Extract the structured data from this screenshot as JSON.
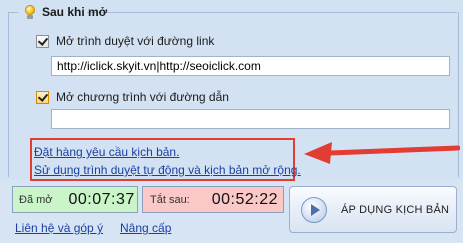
{
  "group": {
    "title": "Sau khi mở"
  },
  "option_browser": {
    "label": "Mở trình duyệt với đường link",
    "checked": true,
    "value": "http://iclick.skyit.vn|http://seoiclick.com"
  },
  "option_program": {
    "label": "Mở chương trình với đường dẫn",
    "checked": true,
    "value": ""
  },
  "links": {
    "order_script": "Đặt hàng yêu cầu kịch bản.",
    "use_browser": "Sử dụng trình duyệt tự động và kịch bản mở rộng."
  },
  "timers": {
    "opened_label": "Đã mở",
    "opened_value": "00:07:37",
    "shutdown_label": "Tắt sau:",
    "shutdown_value": "00:52:22"
  },
  "apply_button": {
    "label": "ÁP DỤNG KỊCH BẢN"
  },
  "footer": {
    "contact": "Liên hệ và góp ý",
    "upgrade": "Nâng cấp"
  },
  "colors": {
    "highlight": "#e33c32",
    "link": "#1b3fa3",
    "timer_green": "#c9f5c9",
    "timer_pink": "#fbc8c8"
  },
  "icons": {
    "group": "lightbulb-icon",
    "apply": "play-icon"
  }
}
